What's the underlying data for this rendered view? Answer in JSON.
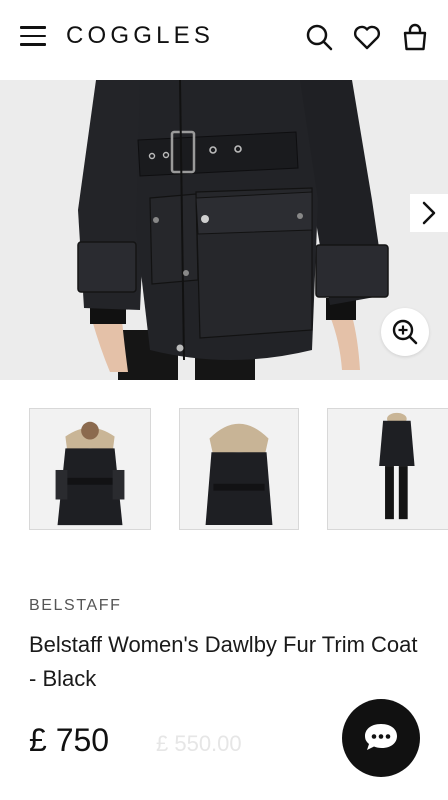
{
  "header": {
    "logo": "COGGLES",
    "icons": [
      "menu-icon",
      "search-icon",
      "heart-icon",
      "bag-icon"
    ]
  },
  "gallery": {
    "main_image_alt": "Belstaff Women's Dawlby Fur Trim Coat - Black",
    "thumbnails": [
      "front view",
      "back view",
      "full length view"
    ]
  },
  "product": {
    "brand": "BELSTAFF",
    "title": "Belstaff Women's Dawlby Fur Trim Coat - Black",
    "price": "£ 750",
    "rrp": "£ 550.00"
  },
  "colors": {
    "coat": "#1f2023",
    "background": "#ececec",
    "chat_button": "#111111"
  }
}
